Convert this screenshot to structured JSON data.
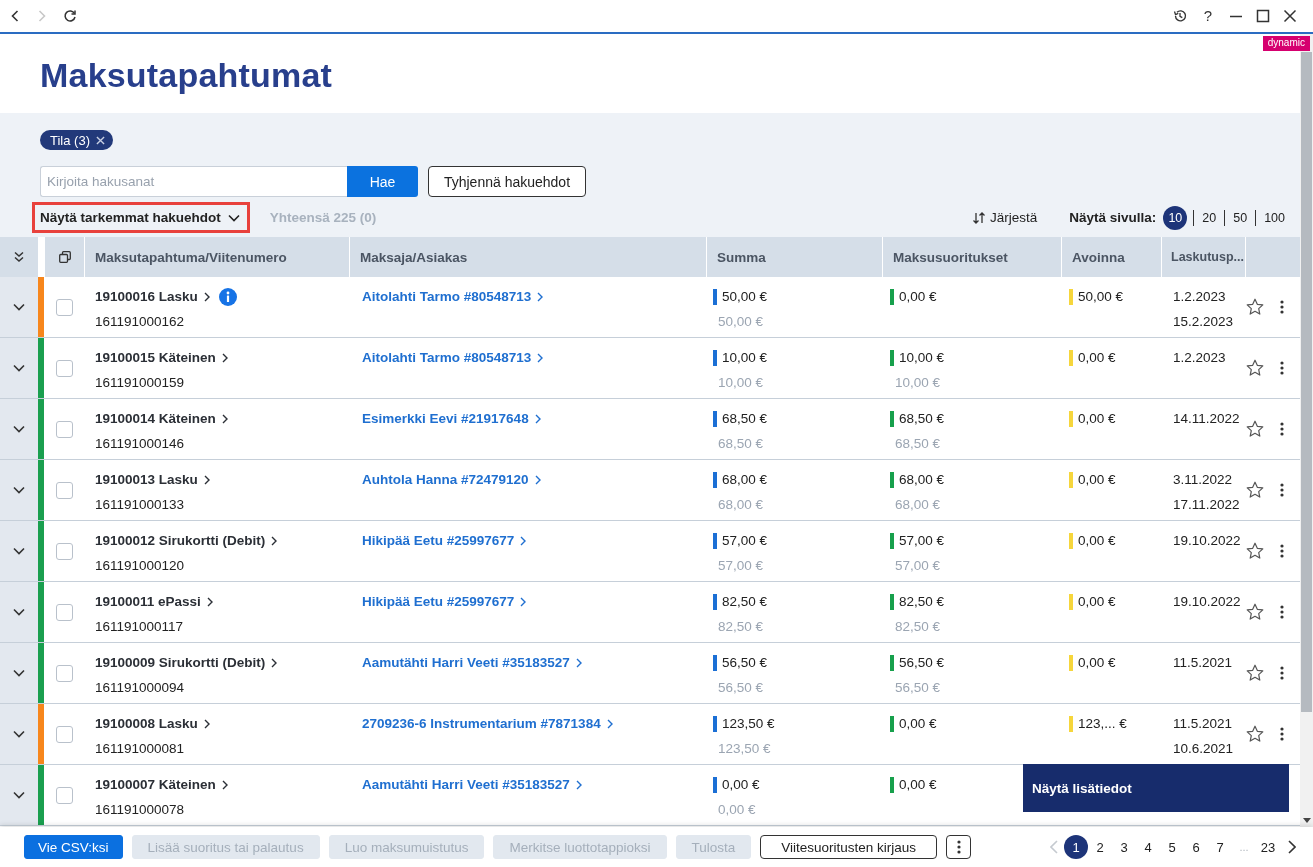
{
  "browser_bar": {
    "back_disabled": false,
    "forward_disabled": true,
    "help": "?"
  },
  "badge": "dynamic",
  "title": "Maksutapahtumat",
  "filters": {
    "chips": [
      {
        "label": "Tila (3)"
      }
    ],
    "search": {
      "placeholder": "Kirjoita hakusanat",
      "button": "Hae"
    },
    "clear_button": "Tyhjennä hakuehdot",
    "more_toggle": {
      "label": "Näytä tarkemmat hakuehdot",
      "highlighted": true
    },
    "total": "Yhteensä 225 (0)",
    "sort_button": "Järjestä",
    "page_size": {
      "label": "Näytä sivulla:",
      "options": [
        {
          "label": "10",
          "selected": true
        },
        {
          "label": "20",
          "selected": false
        },
        {
          "label": "50",
          "selected": false
        },
        {
          "label": "100",
          "selected": false
        }
      ]
    }
  },
  "table": {
    "columns": [
      "Maksutapahtuma/Viitenumero",
      "Maksaja/Asiakas",
      "Summa",
      "Maksusuoritukset",
      "Avoinna",
      "Laskutusp..."
    ],
    "rows": [
      {
        "color": "#f7861c",
        "checked": false,
        "transaction": "19100016 Lasku",
        "info": true,
        "reference": "161191000162",
        "customer": "Aitolahti Tarmo #80548713",
        "sum": [
          "50,00 €",
          "50,00 €"
        ],
        "paid": [
          "0,00 €"
        ],
        "open": "50,00 €",
        "dates": [
          "1.2.2023",
          "15.2.2023"
        ]
      },
      {
        "color": "#1a9f4f",
        "checked": false,
        "transaction": "19100015 Käteinen",
        "info": false,
        "reference": "161191000159",
        "customer": "Aitolahti Tarmo #80548713",
        "sum": [
          "10,00 €",
          "10,00 €"
        ],
        "paid": [
          "10,00 €",
          "10,00 €"
        ],
        "open": "0,00 €",
        "dates": [
          "1.2.2023"
        ]
      },
      {
        "color": "#1a9f4f",
        "checked": false,
        "transaction": "19100014 Käteinen",
        "info": false,
        "reference": "161191000146",
        "customer": "Esimerkki Eevi #21917648",
        "sum": [
          "68,50 €",
          "68,50 €"
        ],
        "paid": [
          "68,50 €",
          "68,50 €"
        ],
        "open": "0,00 €",
        "dates": [
          "14.11.2022"
        ]
      },
      {
        "color": "#1a9f4f",
        "checked": false,
        "transaction": "19100013 Lasku",
        "info": false,
        "reference": "161191000133",
        "customer": "Auhtola Hanna #72479120",
        "sum": [
          "68,00 €",
          "68,00 €"
        ],
        "paid": [
          "68,00 €",
          "68,00 €"
        ],
        "open": "0,00 €",
        "dates": [
          "3.11.2022",
          "17.11.2022"
        ]
      },
      {
        "color": "#1a9f4f",
        "checked": false,
        "transaction": "19100012 Sirukortti (Debit)",
        "info": false,
        "reference": "161191000120",
        "customer": "Hikipää Eetu #25997677",
        "sum": [
          "57,00 €",
          "57,00 €"
        ],
        "paid": [
          "57,00 €",
          "57,00 €"
        ],
        "open": "0,00 €",
        "dates": [
          "19.10.2022"
        ]
      },
      {
        "color": "#1a9f4f",
        "checked": false,
        "transaction": "19100011 ePassi",
        "info": false,
        "reference": "161191000117",
        "customer": "Hikipää Eetu #25997677",
        "sum": [
          "82,50 €",
          "82,50 €"
        ],
        "paid": [
          "82,50 €",
          "82,50 €"
        ],
        "open": "0,00 €",
        "dates": [
          "19.10.2022"
        ]
      },
      {
        "color": "#1a9f4f",
        "checked": false,
        "transaction": "19100009 Sirukortti (Debit)",
        "info": false,
        "reference": "161191000094",
        "customer": "Aamutähti Harri Veeti #35183527",
        "sum": [
          "56,50 €",
          "56,50 €"
        ],
        "paid": [
          "56,50 €",
          "56,50 €"
        ],
        "open": "0,00 €",
        "dates": [
          "11.5.2021"
        ]
      },
      {
        "color": "#f7861c",
        "checked": false,
        "transaction": "19100008 Lasku",
        "info": false,
        "reference": "161191000081",
        "customer": "2709236-6 Instrumentarium #7871384",
        "sum": [
          "123,50 €",
          "123,50 €"
        ],
        "paid": [
          "0,00 €"
        ],
        "open": "123,... €",
        "dates": [
          "11.5.2021",
          "10.6.2021"
        ]
      },
      {
        "color": "#1a9f4f",
        "checked": false,
        "transaction": "19100007 Käteinen",
        "info": false,
        "reference": "161191000078",
        "customer": "Aamutähti Harri Veeti #35183527",
        "sum": [
          "0,00 €",
          "0,00 €"
        ],
        "paid": [
          "0,00 €"
        ],
        "tooltip": "Näytä lisätiedot"
      }
    ]
  },
  "toolbar": {
    "buttons": [
      {
        "label": "Vie CSV:ksi",
        "kind": "primary",
        "disabled": false
      },
      {
        "label": "Lisää suoritus tai palautus",
        "kind": "filled",
        "disabled": true
      },
      {
        "label": "Luo maksumuistutus",
        "kind": "filled",
        "disabled": true
      },
      {
        "label": "Merkitse luottotappioksi",
        "kind": "filled",
        "disabled": true
      },
      {
        "label": "Tulosta",
        "kind": "filled",
        "disabled": true
      },
      {
        "label": "Viitesuoritusten kirjaus",
        "kind": "outline",
        "disabled": false
      }
    ]
  },
  "pagination": {
    "previous_disabled": true,
    "next_disabled": false,
    "pages": [
      {
        "label": "1",
        "selected": true
      },
      {
        "label": "2",
        "selected": false
      },
      {
        "label": "3",
        "selected": false
      },
      {
        "label": "4",
        "selected": false
      },
      {
        "label": "5",
        "selected": false
      },
      {
        "label": "6",
        "selected": false
      },
      {
        "label": "7",
        "selected": false
      }
    ],
    "gap": "...",
    "last_pages": [
      {
        "label": "23",
        "selected": false
      }
    ]
  }
}
